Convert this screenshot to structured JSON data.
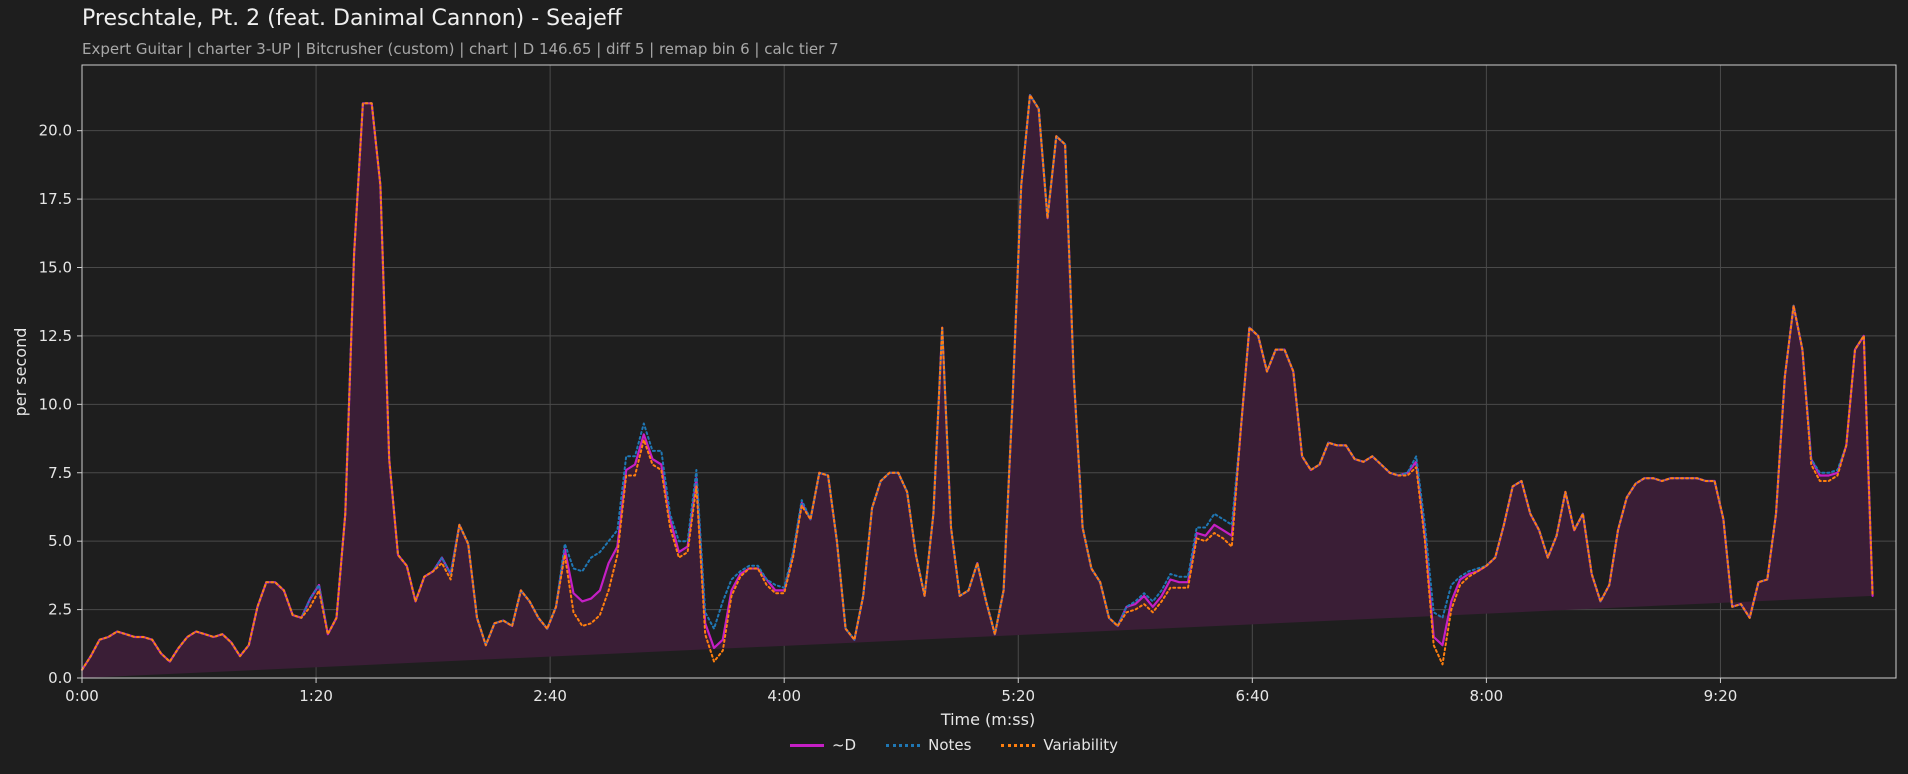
{
  "page": {
    "title": "Preschtale, Pt. 2 (feat. Danimal Cannon) - Seajeff",
    "subtitle": "Expert Guitar  |  charter 3-UP  |  Bitcrusher (custom)  |  chart  |  D 146.65  |  diff 5  |  remap bin 6  |  calc tier 7"
  },
  "colors": {
    "background": "#1e1e1e",
    "grid": "#4a4a4a",
    "d_line": "#c51fc5",
    "notes_line": "#1f77b4",
    "variability_line": "#ff7f0e",
    "fill": "#3a1e36"
  },
  "chart_data": {
    "type": "line",
    "title": "Preschtale, Pt. 2 (feat. Danimal Cannon) - Seajeff",
    "xlabel": "Time (m:ss)",
    "ylabel": "per second",
    "xlim": [
      0,
      620
    ],
    "ylim": [
      0,
      22.4
    ],
    "x_ticks": [
      0,
      80,
      160,
      240,
      320,
      400,
      480,
      560
    ],
    "x_tick_labels": [
      "0:00",
      "1:20",
      "2:40",
      "4:00",
      "5:20",
      "6:40",
      "8:00",
      "9:20"
    ],
    "y_ticks": [
      0,
      2.5,
      5,
      7.5,
      10,
      12.5,
      15,
      17.5,
      20
    ],
    "y_tick_labels": [
      "0.0",
      "2.5",
      "5.0",
      "7.5",
      "10.0",
      "12.5",
      "15.0",
      "17.5",
      "20.0"
    ],
    "grid": true,
    "legend_position": "bottom-center",
    "x": [
      0,
      3,
      6,
      9,
      12,
      15,
      18,
      21,
      24,
      27,
      30,
      33,
      36,
      39,
      42,
      45,
      48,
      51,
      54,
      57,
      60,
      63,
      66,
      69,
      72,
      75,
      78,
      81,
      84,
      87,
      90,
      93,
      96,
      99,
      102,
      105,
      108,
      111,
      114,
      117,
      120,
      123,
      126,
      129,
      132,
      135,
      138,
      141,
      144,
      147,
      150,
      153,
      156,
      159,
      162,
      165,
      168,
      171,
      174,
      177,
      180,
      183,
      186,
      189,
      192,
      195,
      198,
      201,
      204,
      207,
      210,
      213,
      216,
      219,
      222,
      225,
      228,
      231,
      234,
      237,
      240,
      243,
      246,
      249,
      252,
      255,
      258,
      261,
      264,
      267,
      270,
      273,
      276,
      279,
      282,
      285,
      288,
      291,
      294,
      297,
      300,
      303,
      306,
      309,
      312,
      315,
      318,
      321,
      324,
      327,
      330,
      333,
      336,
      339,
      342,
      345,
      348,
      351,
      354,
      357,
      360,
      363,
      366,
      369,
      372,
      375,
      378,
      381,
      384,
      387,
      390,
      393,
      396,
      399,
      402,
      405,
      408,
      411,
      414,
      417,
      420,
      423,
      426,
      429,
      432,
      435,
      438,
      441,
      444,
      447,
      450,
      453,
      456,
      459,
      462,
      465,
      468,
      471,
      474,
      477,
      480,
      483,
      486,
      489,
      492,
      495,
      498,
      501,
      504,
      507,
      510,
      513,
      516,
      519,
      522,
      525,
      528,
      531,
      534,
      537,
      540,
      543,
      546,
      549,
      552,
      555,
      558,
      561,
      564,
      567,
      570,
      573,
      576,
      579,
      582,
      585,
      588,
      591,
      594,
      597,
      600,
      603,
      606,
      609,
      612,
      615,
      618,
      620
    ],
    "series": [
      {
        "name": "~D",
        "values": [
          0.3,
          0.8,
          1.4,
          1.5,
          1.7,
          1.6,
          1.5,
          1.5,
          1.4,
          0.9,
          0.6,
          1.1,
          1.5,
          1.7,
          1.6,
          1.5,
          1.6,
          1.3,
          0.8,
          1.2,
          2.6,
          3.5,
          3.5,
          3.2,
          2.3,
          2.2,
          2.9,
          3.4,
          1.6,
          2.2,
          6.0,
          15.5,
          21.0,
          21.0,
          18.0,
          8.0,
          4.5,
          4.1,
          2.8,
          3.7,
          3.9,
          4.4,
          3.8,
          5.6,
          4.9,
          2.2,
          1.2,
          2.0,
          2.1,
          1.9,
          3.2,
          2.8,
          2.2,
          1.8,
          2.6,
          4.7,
          3.1,
          2.8,
          2.9,
          3.2,
          4.2,
          4.8,
          7.6,
          7.8,
          8.9,
          8.0,
          7.8,
          5.8,
          4.6,
          4.8,
          7.3,
          2.0,
          1.1,
          1.4,
          3.2,
          3.8,
          4.0,
          4.0,
          3.6,
          3.2,
          3.2,
          4.5,
          6.4,
          5.8,
          7.5,
          7.4,
          5.0,
          1.8,
          1.4,
          3.0,
          6.2,
          7.2,
          7.5,
          7.5,
          6.8,
          4.5,
          3.0,
          6.0,
          12.8,
          5.5,
          3.0,
          3.2,
          4.2,
          2.8,
          1.6,
          3.2,
          10.0,
          18.0,
          21.3,
          20.8,
          16.8,
          19.8,
          19.5,
          11.0,
          5.5,
          4.0,
          3.5,
          2.2,
          1.9,
          2.6,
          2.7,
          3.0,
          2.6,
          3.0,
          3.6,
          3.5,
          3.5,
          5.3,
          5.2,
          5.6,
          5.4,
          5.2,
          9.0,
          12.8,
          12.5,
          11.2,
          12.0,
          12.0,
          11.2,
          8.1,
          7.6,
          7.8,
          8.6,
          8.5,
          8.5,
          8.0,
          7.9,
          8.1,
          7.8,
          7.5,
          7.4,
          7.5,
          7.9,
          5.2,
          1.5,
          1.2,
          2.8,
          3.6,
          3.8,
          3.9,
          4.1,
          4.4,
          5.6,
          7.0,
          7.2,
          6.0,
          5.4,
          4.4,
          5.2,
          6.8,
          5.4,
          6.0,
          3.8,
          2.8,
          3.4,
          5.4,
          6.6,
          7.1,
          7.3,
          7.3,
          7.2,
          7.3,
          7.3,
          7.3,
          7.3,
          7.2,
          7.2,
          5.8,
          2.6,
          2.7,
          2.2,
          3.5,
          3.6,
          6.0,
          11.0,
          13.6,
          12.0,
          8.0,
          7.4,
          7.4,
          7.5,
          8.5,
          12.0,
          12.5,
          3.0
        ]
      },
      {
        "name": "Notes",
        "values": [
          0.3,
          0.8,
          1.4,
          1.5,
          1.7,
          1.6,
          1.5,
          1.5,
          1.4,
          0.9,
          0.6,
          1.1,
          1.5,
          1.7,
          1.6,
          1.5,
          1.6,
          1.3,
          0.8,
          1.2,
          2.6,
          3.5,
          3.5,
          3.2,
          2.3,
          2.2,
          2.9,
          3.4,
          1.6,
          2.2,
          6.0,
          15.5,
          21.0,
          21.0,
          18.0,
          8.0,
          4.5,
          4.1,
          2.8,
          3.7,
          3.9,
          4.4,
          3.8,
          5.6,
          4.9,
          2.2,
          1.2,
          2.0,
          2.1,
          1.9,
          3.2,
          2.8,
          2.2,
          1.8,
          2.6,
          4.9,
          4.0,
          3.9,
          4.4,
          4.6,
          5.0,
          5.4,
          8.1,
          8.1,
          9.3,
          8.3,
          8.3,
          6.0,
          5.0,
          5.0,
          7.6,
          2.4,
          1.8,
          2.8,
          3.6,
          3.9,
          4.1,
          4.1,
          3.6,
          3.4,
          3.3,
          4.6,
          6.5,
          5.8,
          7.5,
          7.4,
          5.0,
          1.8,
          1.4,
          3.0,
          6.2,
          7.2,
          7.5,
          7.5,
          6.8,
          4.5,
          3.0,
          6.0,
          12.8,
          5.5,
          3.0,
          3.2,
          4.2,
          2.8,
          1.6,
          3.2,
          10.0,
          18.0,
          21.3,
          20.8,
          16.8,
          19.8,
          19.5,
          11.0,
          5.5,
          4.0,
          3.5,
          2.2,
          1.9,
          2.6,
          2.8,
          3.1,
          2.8,
          3.2,
          3.8,
          3.7,
          3.7,
          5.5,
          5.5,
          6.0,
          5.8,
          5.6,
          9.0,
          12.8,
          12.5,
          11.2,
          12.0,
          12.0,
          11.2,
          8.1,
          7.6,
          7.8,
          8.6,
          8.5,
          8.5,
          8.0,
          7.9,
          8.1,
          7.8,
          7.5,
          7.4,
          7.5,
          8.1,
          5.6,
          2.4,
          2.2,
          3.4,
          3.7,
          3.9,
          4.0,
          4.1,
          4.4,
          5.6,
          7.0,
          7.2,
          6.0,
          5.4,
          4.4,
          5.2,
          6.8,
          5.4,
          6.0,
          3.8,
          2.8,
          3.4,
          5.4,
          6.6,
          7.1,
          7.3,
          7.3,
          7.2,
          7.3,
          7.3,
          7.3,
          7.3,
          7.2,
          7.2,
          5.8,
          2.6,
          2.7,
          2.2,
          3.5,
          3.6,
          6.0,
          11.0,
          13.6,
          12.0,
          8.0,
          7.5,
          7.5,
          7.6,
          8.5,
          12.0,
          12.5,
          3.0
        ]
      },
      {
        "name": "Variability",
        "values": [
          0.3,
          0.8,
          1.4,
          1.5,
          1.7,
          1.6,
          1.5,
          1.5,
          1.4,
          0.9,
          0.6,
          1.1,
          1.5,
          1.7,
          1.6,
          1.5,
          1.6,
          1.3,
          0.8,
          1.2,
          2.6,
          3.5,
          3.5,
          3.2,
          2.3,
          2.2,
          2.6,
          3.2,
          1.6,
          2.2,
          6.0,
          15.5,
          21.0,
          21.0,
          18.0,
          8.0,
          4.5,
          4.1,
          2.8,
          3.7,
          3.9,
          4.2,
          3.6,
          5.6,
          4.9,
          2.2,
          1.2,
          2.0,
          2.1,
          1.9,
          3.2,
          2.8,
          2.2,
          1.8,
          2.6,
          4.5,
          2.4,
          1.9,
          2.0,
          2.3,
          3.2,
          4.5,
          7.4,
          7.4,
          8.7,
          7.8,
          7.6,
          5.5,
          4.4,
          4.6,
          7.0,
          1.6,
          0.6,
          1.0,
          3.0,
          3.7,
          4.0,
          4.0,
          3.4,
          3.1,
          3.1,
          4.4,
          6.3,
          5.8,
          7.5,
          7.4,
          5.0,
          1.8,
          1.4,
          3.0,
          6.2,
          7.2,
          7.5,
          7.5,
          6.8,
          4.5,
          3.0,
          6.0,
          12.8,
          5.5,
          3.0,
          3.2,
          4.2,
          2.8,
          1.6,
          3.2,
          10.0,
          18.0,
          21.3,
          20.8,
          16.8,
          19.8,
          19.5,
          11.0,
          5.5,
          4.0,
          3.5,
          2.2,
          1.9,
          2.4,
          2.5,
          2.7,
          2.4,
          2.8,
          3.3,
          3.3,
          3.3,
          5.1,
          5.0,
          5.3,
          5.1,
          4.8,
          9.0,
          12.8,
          12.5,
          11.2,
          12.0,
          12.0,
          11.2,
          8.1,
          7.6,
          7.8,
          8.6,
          8.5,
          8.5,
          8.0,
          7.9,
          8.1,
          7.8,
          7.5,
          7.4,
          7.4,
          7.7,
          5.0,
          1.2,
          0.5,
          2.5,
          3.4,
          3.7,
          3.9,
          4.1,
          4.4,
          5.6,
          7.0,
          7.2,
          6.0,
          5.4,
          4.4,
          5.2,
          6.8,
          5.4,
          6.0,
          3.8,
          2.8,
          3.4,
          5.4,
          6.6,
          7.1,
          7.3,
          7.3,
          7.2,
          7.3,
          7.3,
          7.3,
          7.3,
          7.2,
          7.2,
          5.8,
          2.6,
          2.7,
          2.2,
          3.5,
          3.6,
          6.0,
          11.0,
          13.6,
          12.0,
          7.8,
          7.2,
          7.2,
          7.4,
          8.5,
          12.0,
          12.5,
          3.0
        ]
      }
    ]
  }
}
